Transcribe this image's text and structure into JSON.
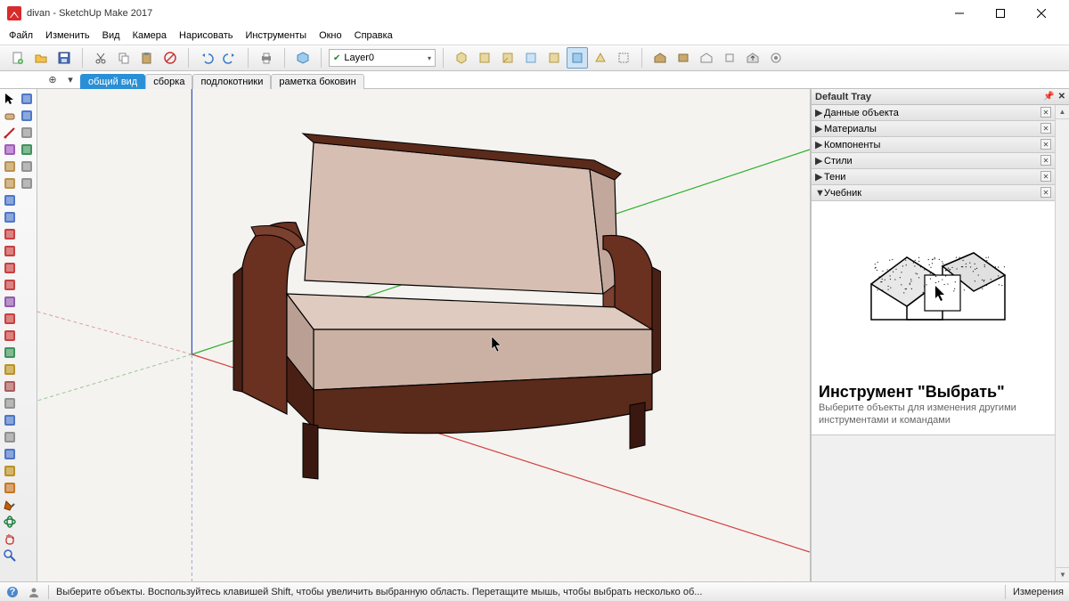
{
  "titlebar": {
    "text": "divan - SketchUp Make 2017"
  },
  "menu": [
    "Файл",
    "Изменить",
    "Вид",
    "Камера",
    "Нарисовать",
    "Инструменты",
    "Окно",
    "Справка"
  ],
  "layer_combo": {
    "value": "Layer0"
  },
  "scene_tabs": {
    "items": [
      {
        "label": "общий вид",
        "active": true
      },
      {
        "label": "сборка",
        "active": false
      },
      {
        "label": "подлокотники",
        "active": false
      },
      {
        "label": "раметка боковин",
        "active": false
      }
    ]
  },
  "tray": {
    "title": "Default Tray",
    "panels": [
      {
        "label": "Данные объекта",
        "expanded": false
      },
      {
        "label": "Материалы",
        "expanded": false
      },
      {
        "label": "Компоненты",
        "expanded": false
      },
      {
        "label": "Стили",
        "expanded": false
      },
      {
        "label": "Тени",
        "expanded": false
      },
      {
        "label": "Учебник",
        "expanded": true
      }
    ],
    "instructor": {
      "title": "Инструмент \"Выбрать\"",
      "desc": "Выберите объекты для изменения другими инструментами и командами"
    }
  },
  "statusbar": {
    "hint": "Выберите объекты. Воспользуйтесь клавишей Shift, чтобы увеличить выбранную область. Перетащите мышь, чтобы выбрать несколько об...",
    "measure_label": "Измерения"
  },
  "top_toolbar_icons": [
    "new-file-icon",
    "open-file-icon",
    "save-file-icon",
    "cut-icon",
    "copy-icon",
    "paste-icon",
    "delete-icon",
    "undo-icon",
    "redo-icon",
    "print-icon",
    "model-info-icon",
    "layer-combo",
    "iso-view-icon",
    "top-view-icon",
    "front-view-icon",
    "right-view-icon",
    "back-view-icon",
    "left-view-icon",
    "perspective-icon",
    "xray-icon",
    "3dwarehouse-icon",
    "share-icon",
    "extension-icon",
    "geolocate-icon",
    "settings-icon",
    "preferences-icon"
  ],
  "left_tools": [
    "select-icon",
    "eraser-icon",
    "line-icon",
    "freehand-icon",
    "rectangle-icon",
    "rotated-rect-icon",
    "circle-icon",
    "polygon-icon",
    "arc-icon",
    "2pt-arc-icon",
    "3pt-arc-icon",
    "pie-icon",
    "pushpull-icon",
    "offset-icon",
    "move-icon",
    "rotate-icon",
    "scale-icon",
    "followme-icon",
    "tape-icon",
    "dimension-icon",
    "protractor-icon",
    "text-icon",
    "axes-icon",
    "section-icon",
    "paint-icon",
    "orbit-icon",
    "pan-icon",
    "zoom-icon",
    "zoom-window-icon",
    "zoom-extents-icon",
    "position-camera-icon",
    "look-around-icon",
    "walk-icon",
    "prev-view-icon"
  ],
  "left_tool_colors": [
    "#000",
    "#a04040",
    "#c02020",
    "#9040b0",
    "#b08030",
    "#b08030",
    "#3060c0",
    "#3060c0",
    "#c02020",
    "#c02020",
    "#c02020",
    "#c02020",
    "#8040a0",
    "#c02020",
    "#c02020",
    "#208040",
    "#b08000",
    "#a04040",
    "#808080",
    "#3060c0",
    "#808080",
    "#3060c0",
    "#b08000",
    "#c06000",
    "#c06000",
    "#208040",
    "#c02020",
    "#3060c0",
    "#3060c0",
    "#3060c0",
    "#808080",
    "#208040",
    "#808080",
    "#808080"
  ]
}
